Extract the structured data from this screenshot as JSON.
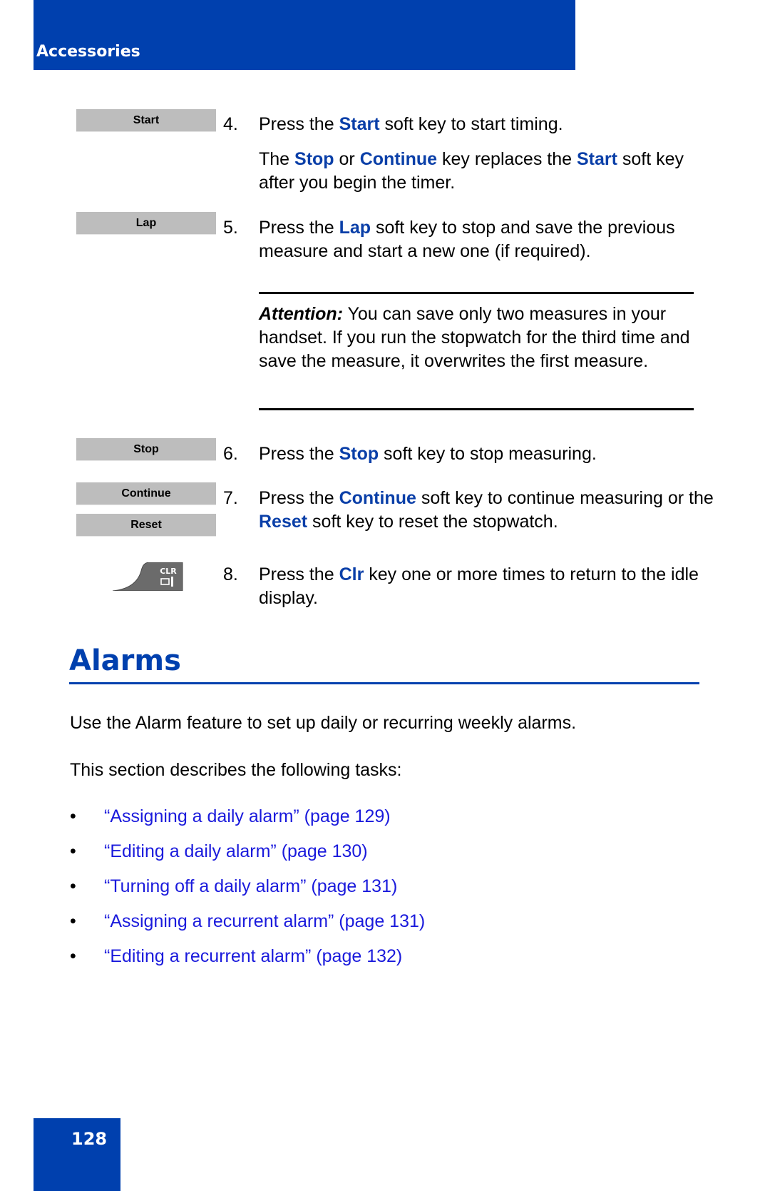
{
  "header": {
    "title": "Accessories"
  },
  "softkeys": {
    "start": "Start",
    "lap": "Lap",
    "stop": "Stop",
    "continue": "Continue",
    "reset": "Reset",
    "clr_label": "CLR"
  },
  "steps": [
    {
      "num": "4.",
      "pre": "Press the ",
      "key": "Start",
      "post": " soft key to start timing."
    },
    {
      "num": "5.",
      "pre": "Press the ",
      "key": "Lap",
      "post": " soft key to stop and save the previous measure and start a new one (if required)."
    },
    {
      "num": "6.",
      "pre": "Press the ",
      "key": "Stop",
      "post": " soft key to stop measuring."
    },
    {
      "num": "7.",
      "pre": "Press the ",
      "key": "Continue",
      "mid": " soft key to continue measuring or the ",
      "key2": "Reset",
      "post": " soft key to reset the stopwatch."
    },
    {
      "num": "8.",
      "pre": "Press the ",
      "key": "Clr",
      "post": " key one or more times to return to the idle display."
    }
  ],
  "step4_note": {
    "pre": "The ",
    "key1": "Stop",
    "mid1": " or ",
    "key2": "Continue",
    "mid2": " key replaces the ",
    "key3": "Start",
    "post": " soft key after you begin the timer."
  },
  "attention": {
    "label": "Attention:",
    "text": " You can save only two measures in your handset. If you run the stopwatch for the third time and save the measure, it overwrites the first measure."
  },
  "section": {
    "title": "Alarms",
    "intro": "Use the Alarm feature to set up daily or recurring weekly alarms.",
    "tasks_intro": "This section describes the following tasks:",
    "bullet": "•",
    "links": [
      "“Assigning a daily alarm” (page 129)",
      "“Editing a daily alarm” (page 130)",
      "“Turning off a daily alarm” (page 131)",
      "“Assigning a recurrent alarm” (page 131)",
      "“Editing a recurrent alarm” (page 132)"
    ]
  },
  "footer": {
    "page_number": "128"
  },
  "colors": {
    "brand_blue": "#0040ae",
    "keyword_blue": "#0a3fa8",
    "link_blue": "#1a1adc",
    "softkey_gray": "#bdbdbd"
  }
}
